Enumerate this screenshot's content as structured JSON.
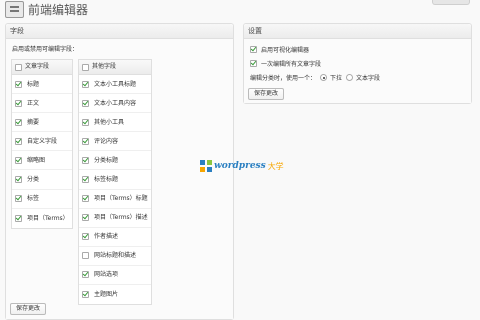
{
  "page": {
    "title": "前端编辑器"
  },
  "fields_panel": {
    "title": "字段",
    "description": "启用或禁用可编辑字段：",
    "save_label": "保存更改",
    "columns": [
      {
        "header": "文章字段",
        "header_checked": false,
        "items": [
          {
            "label": "标题",
            "checked": true
          },
          {
            "label": "正文",
            "checked": true
          },
          {
            "label": "摘要",
            "checked": true
          },
          {
            "label": "自定义字段",
            "checked": true
          },
          {
            "label": "缩略图",
            "checked": true
          },
          {
            "label": "分类",
            "checked": true
          },
          {
            "label": "标签",
            "checked": true
          },
          {
            "label": "项目（Terms）",
            "checked": true
          }
        ]
      },
      {
        "header": "其他字段",
        "header_checked": false,
        "items": [
          {
            "label": "文本小工具标题",
            "checked": true
          },
          {
            "label": "文本小工具内容",
            "checked": true
          },
          {
            "label": "其他小工具",
            "checked": true
          },
          {
            "label": "评论内容",
            "checked": true
          },
          {
            "label": "分类标题",
            "checked": true
          },
          {
            "label": "标签标题",
            "checked": true
          },
          {
            "label": "项目（Terms）标题",
            "checked": true
          },
          {
            "label": "项目（Terms）描述",
            "checked": true
          },
          {
            "label": "作者描述",
            "checked": true
          },
          {
            "label": "网站标题和描述",
            "checked": false
          },
          {
            "label": "网站选项",
            "checked": true
          },
          {
            "label": "主题图片",
            "checked": true
          }
        ]
      }
    ]
  },
  "settings_panel": {
    "title": "设置",
    "options": [
      {
        "label": "启用可视化编辑器",
        "checked": true
      },
      {
        "label": "一次编辑所有文章字段",
        "checked": true
      }
    ],
    "taxonomy_label": "编辑分类时，使用一个：",
    "radios": [
      {
        "label": "下拉",
        "checked": true
      },
      {
        "label": "文本字段",
        "checked": false
      }
    ],
    "save_label": "保存更改"
  },
  "watermark": {
    "text": "wordpress",
    "suffix": "大学"
  },
  "colors": {
    "accent": "#21759b",
    "check": "#3a9a3a",
    "watermark_blue": "#2a7fc1"
  }
}
